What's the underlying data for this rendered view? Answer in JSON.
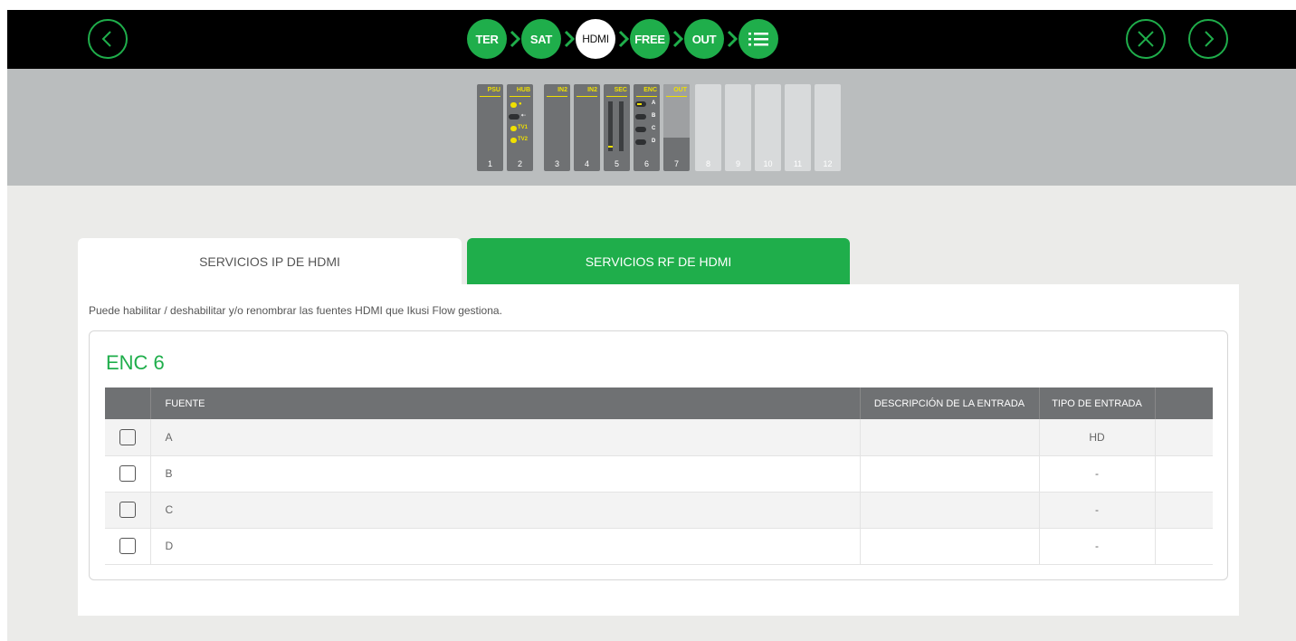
{
  "steps": [
    "TER",
    "SAT",
    "HDMI",
    "FREE",
    "OUT"
  ],
  "active_step": "HDMI",
  "accent_color": "#1fae4b",
  "icons": {
    "back": "chevron-left-icon",
    "close": "close-icon",
    "next": "chevron-right-icon",
    "menu": "list-icon"
  },
  "rack": {
    "slots": [
      {
        "num": "1",
        "label": "PSU"
      },
      {
        "num": "2",
        "label": "HUB",
        "leds": [
          "TV1",
          "TV2"
        ]
      },
      {
        "num": "3",
        "label": "IN2"
      },
      {
        "num": "4",
        "label": "IN2"
      },
      {
        "num": "5",
        "label": "SEC"
      },
      {
        "num": "6",
        "label": "ENC",
        "leds": [
          "A",
          "B",
          "C",
          "D"
        ]
      },
      {
        "num": "7",
        "label": "OUT"
      },
      {
        "num": "8"
      },
      {
        "num": "9"
      },
      {
        "num": "10"
      },
      {
        "num": "11"
      },
      {
        "num": "12"
      }
    ]
  },
  "tabs": {
    "ip": "SERVICIOS IP DE HDMI",
    "rf": "SERVICIOS RF DE HDMI"
  },
  "description": "Puede habilitar / deshabilitar y/o renombrar las fuentes HDMI que Ikusi Flow gestiona.",
  "encoder": {
    "title": "ENC 6",
    "columns": {
      "source": "FUENTE",
      "description": "DESCRIPCIÓN DE LA ENTRADA",
      "type": "TIPO DE ENTRADA"
    },
    "rows": [
      {
        "source": "A",
        "description": "",
        "type": "HD",
        "checked": false
      },
      {
        "source": "B",
        "description": "",
        "type": "-",
        "checked": false
      },
      {
        "source": "C",
        "description": "",
        "type": "-",
        "checked": false
      },
      {
        "source": "D",
        "description": "",
        "type": "-",
        "checked": false
      }
    ]
  }
}
